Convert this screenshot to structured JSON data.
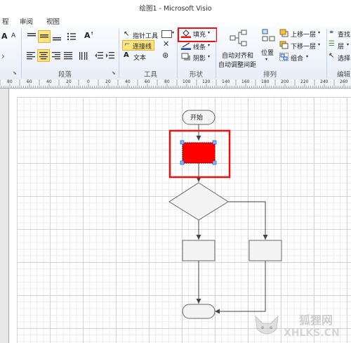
{
  "window": {
    "title": "绘图1 - Microsoft Visio"
  },
  "menu": {
    "items": [
      "程",
      "审阅",
      "视图"
    ]
  },
  "ribbon": {
    "groups": {
      "paragraph": "段落",
      "tools": "工具",
      "shape": "形状",
      "arrange": "排列",
      "edit": "编辑"
    },
    "tools": {
      "pointer": "指针工具",
      "connector": "连接线",
      "text": "文本"
    },
    "shape": {
      "fill": "填充",
      "line": "线条",
      "shadow": "阴影"
    },
    "arrange": {
      "auto_align_line1": "自动对齐和",
      "auto_align_line2": "自动调整间距",
      "position": "位置",
      "bring_forward": "上移一层",
      "send_backward": "下移一层",
      "group": "组合"
    },
    "edit": {
      "find": "查找",
      "layer": "层",
      "select": "选择"
    }
  },
  "ruler": {
    "labels": [
      "80",
      "60",
      "40",
      "20",
      "0",
      "20",
      "40",
      "60",
      "80",
      "100",
      "120",
      "140",
      "160",
      "180",
      "200",
      "220",
      "240",
      "260"
    ]
  },
  "diagram": {
    "start_label": "开始",
    "fill_color": "#ff0000",
    "highlight_color": "#e11111"
  },
  "watermark": {
    "line1": "狐狸网",
    "line2": "XHLKS.CN"
  }
}
